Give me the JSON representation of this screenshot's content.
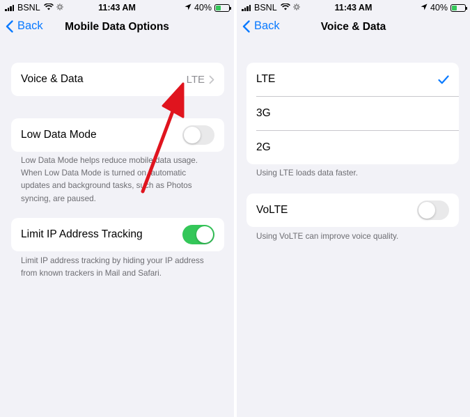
{
  "status_bar": {
    "carrier": "BSNL",
    "time": "11:43 AM",
    "battery": "40%",
    "battery_level": 0.4
  },
  "left": {
    "nav": {
      "back_label": "Back",
      "title": "Mobile Data Options"
    },
    "voice_data_row": {
      "label": "Voice & Data",
      "value": "LTE"
    },
    "low_data_mode": {
      "label": "Low Data Mode",
      "enabled": false,
      "footnote": [
        "Low Data Mode helps reduce mobile data usage.",
        "When Low Data Mode is turned on, automatic",
        "updates and background tasks, such as Photos",
        "syncing, are paused."
      ]
    },
    "limit_ip": {
      "label": "Limit IP Address Tracking",
      "enabled": true,
      "footnote": [
        "Limit IP address tracking by hiding your IP address",
        "from known trackers in Mail and Safari."
      ]
    }
  },
  "right": {
    "nav": {
      "back_label": "Back",
      "title": "Voice & Data"
    },
    "options": [
      {
        "label": "LTE",
        "selected": true
      },
      {
        "label": "3G",
        "selected": false
      },
      {
        "label": "2G",
        "selected": false
      }
    ],
    "options_footnote": "Using LTE loads data faster.",
    "volte": {
      "label": "VoLTE",
      "enabled": false,
      "footnote": "Using VoLTE can improve voice quality."
    }
  },
  "icons": {
    "signal": "cellular-signal-icon",
    "wifi": "wifi-icon",
    "activity": "activity-spinner-icon",
    "location": "location-arrow-icon",
    "battery": "battery-charging-icon",
    "back": "chevron-left-icon",
    "disclosure": "chevron-right-icon",
    "checkmark": "checkmark-icon",
    "annotation": "red-arrow-annotation"
  },
  "colors": {
    "accent": "#0a7aff",
    "toggle_on": "#34c759",
    "annotation_arrow": "#e0141e",
    "background": "#f2f2f7"
  }
}
